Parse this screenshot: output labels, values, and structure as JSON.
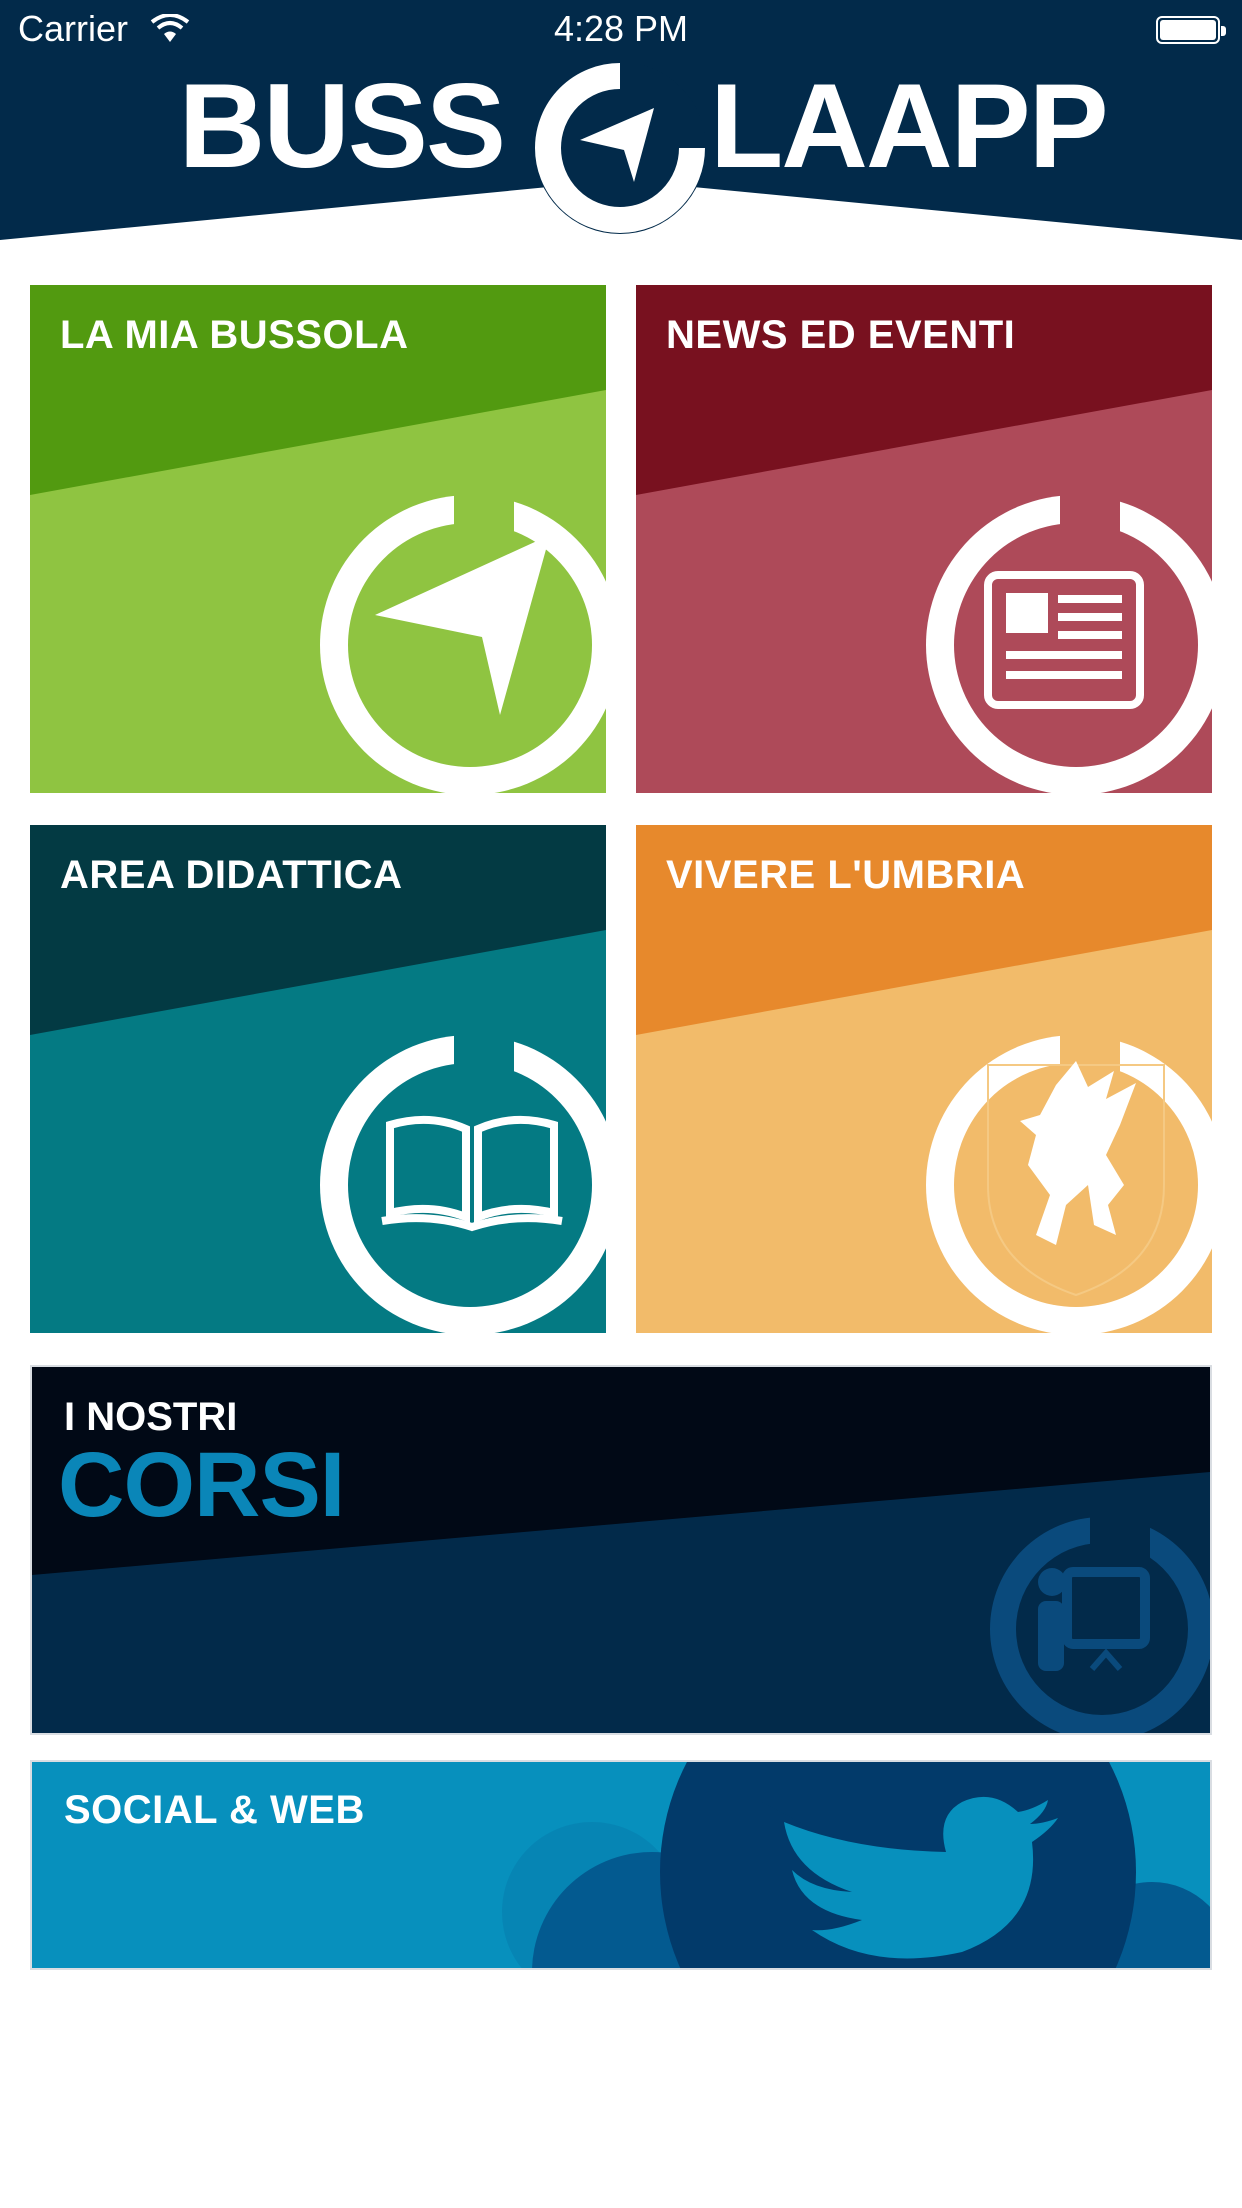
{
  "status_bar": {
    "carrier": "Carrier",
    "time": "4:28 PM"
  },
  "header": {
    "logo_left": "BUSS",
    "logo_right": "LAAPP",
    "background_color": "#022a4a"
  },
  "tiles": [
    {
      "label": "LA MIA BUSSOLA",
      "color_top": "#529a10",
      "color_bottom": "#8fc441",
      "icon": "compass-arrow-icon"
    },
    {
      "label": "NEWS ED EVENTI",
      "color_top": "#78111f",
      "color_bottom": "#ae4a59",
      "icon": "newspaper-icon"
    },
    {
      "label": "AREA DIDATTICA",
      "color_top": "#033a43",
      "color_bottom": "#047a83",
      "icon": "open-book-icon"
    },
    {
      "label": "VIVERE L'UMBRIA",
      "color_top": "#e7892c",
      "color_bottom": "#f2bb6a",
      "icon": "griffin-crest-icon"
    }
  ],
  "corsi": {
    "pre": "I NOSTRI",
    "title": "CORSI",
    "icon": "teacher-presentation-icon",
    "accent": "#0a86b8"
  },
  "social": {
    "label": "SOCIAL & WEB",
    "icon": "twitter-bird-icon",
    "color": "#0790bd"
  }
}
